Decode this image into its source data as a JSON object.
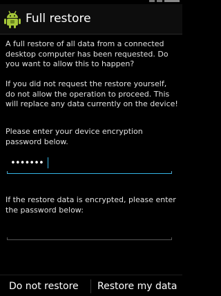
{
  "title_bar": {
    "icon": "android-icon",
    "title": "Full restore"
  },
  "messages": {
    "intro": "A full restore of all data from a connected desktop computer has been requested. Do you want to allow this to happen?",
    "warning": "If you did not request the restore yourself, do not allow the operation to proceed. This will replace any data currently on the device!",
    "device_password_prompt": "Please enter your device encryption password below.",
    "restore_password_prompt": "If the restore data is encrypted, please enter the password below:"
  },
  "fields": {
    "device_password": {
      "value": "•••••••",
      "focused": true
    },
    "restore_password": {
      "value": "",
      "focused": false
    }
  },
  "buttons": {
    "deny": "Do not restore",
    "allow": "Restore my data"
  },
  "colors": {
    "background": "#000000",
    "accent": "#33b5e5",
    "android_green": "#a4c639",
    "text": "#e1e1e1"
  }
}
